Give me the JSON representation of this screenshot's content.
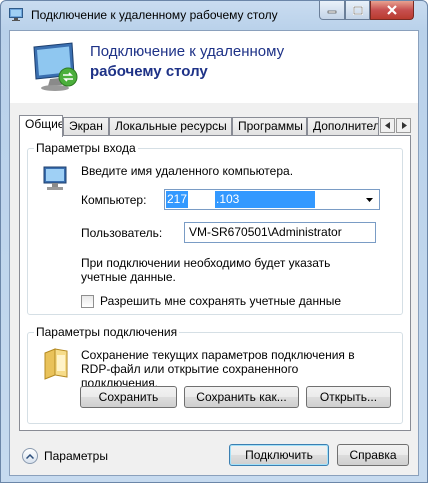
{
  "window": {
    "title": "Подключение к удаленному рабочему столу",
    "titlebar_icon": "remote-desktop-icon",
    "controls": {
      "minimize_icon": "minimize-icon",
      "maximize_icon": "maximize-icon",
      "close_icon": "close-icon"
    }
  },
  "header": {
    "line1": "Подключение к удаленному",
    "line2": "рабочему столу",
    "icon": "remote-desktop-monitor-icon"
  },
  "tabs": [
    {
      "label": "Общие",
      "active": true
    },
    {
      "label": "Экран",
      "active": false
    },
    {
      "label": "Локальные ресурсы",
      "active": false
    },
    {
      "label": "Программы",
      "active": false
    },
    {
      "label": "Дополнительно",
      "active": false
    }
  ],
  "tab_scroll": {
    "left_icon": "chevron-left-icon",
    "right_icon": "chevron-right-icon"
  },
  "logon": {
    "group_title": "Параметры входа",
    "icon": "computer-icon",
    "instruction": "Введите имя удаленного компьютера.",
    "computer_label": "Компьютер:",
    "computer_value_a": "217",
    "computer_value_b": ".103",
    "user_label": "Пользователь:",
    "user_value": "VM-SR670501\\Administrator",
    "note": "При подключении необходимо будет указать учетные данные.",
    "save_credentials_label": "Разрешить мне сохранять учетные данные",
    "save_credentials_checked": false
  },
  "connection": {
    "group_title": "Параметры подключения",
    "icon": "folder-icon",
    "description": "Сохранение текущих параметров подключения в RDP-файл или открытие сохраненного подключения.",
    "save_button": "Сохранить",
    "save_as_button": "Сохранить как...",
    "open_button": "Открыть..."
  },
  "footer": {
    "options_label": "Параметры",
    "expand_icon": "chevron-up-icon",
    "connect_button": "Подключить",
    "help_button": "Справка"
  }
}
